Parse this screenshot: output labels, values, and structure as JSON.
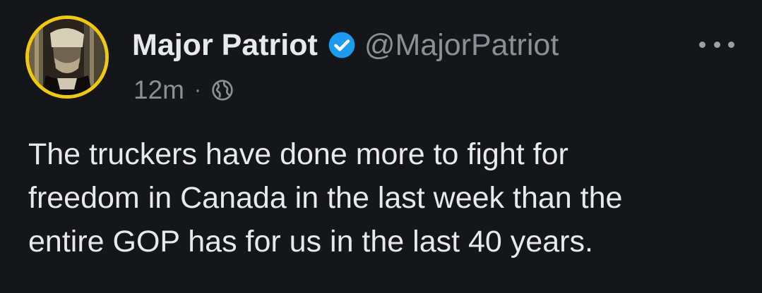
{
  "tweet": {
    "author": {
      "display_name": "Major Patriot",
      "handle": "@MajorPatriot",
      "verified": true,
      "avatar_border_color": "#f0c80f"
    },
    "timestamp": "12m",
    "separator": "·",
    "visibility_icon": "globe-icon",
    "menu_icon": "more-options-icon",
    "text_lines": [
      "The truckers have done more to fight for",
      "freedom in Canada in the last week than the",
      "entire GOP has for us in the last 40 years."
    ]
  },
  "colors": {
    "background": "#15161a",
    "primary_text": "#e7e9ea",
    "secondary_text": "#8b9096",
    "verified_badge": "#1d9bf0"
  }
}
